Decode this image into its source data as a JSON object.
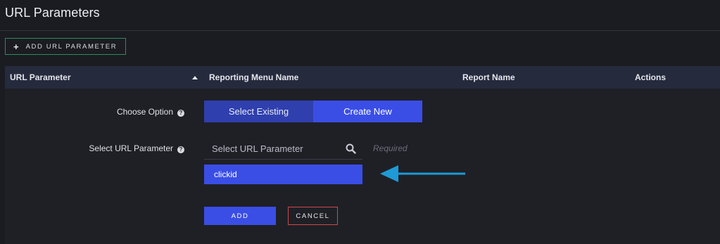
{
  "page": {
    "title": "URL Parameters"
  },
  "toolbar": {
    "add_param_label": "ADD URL PARAMETER",
    "add_icon": "plus-icon"
  },
  "table": {
    "headers": [
      "URL Parameter",
      "Reporting Menu Name",
      "Report Name",
      "Actions"
    ],
    "sort_icon": "sort-up-icon"
  },
  "form": {
    "choose_option_label": "Choose Option",
    "choose_options": [
      "Select Existing",
      "Create New"
    ],
    "selected_option": "Create New",
    "select_param_label": "Select URL Parameter",
    "search_placeholder": "Select URL Parameter",
    "search_value": "",
    "required_text": "Required",
    "dropdown_options": [
      "clickid"
    ],
    "add_label": "ADD",
    "cancel_label": "CANCEL"
  },
  "colors": {
    "accent": "#3a4ee6",
    "accent_dark": "#2f3fae",
    "add_outline": "#2f8a5a",
    "cancel_outline": "#c94a4a",
    "arrow": "#1e9ad6"
  }
}
